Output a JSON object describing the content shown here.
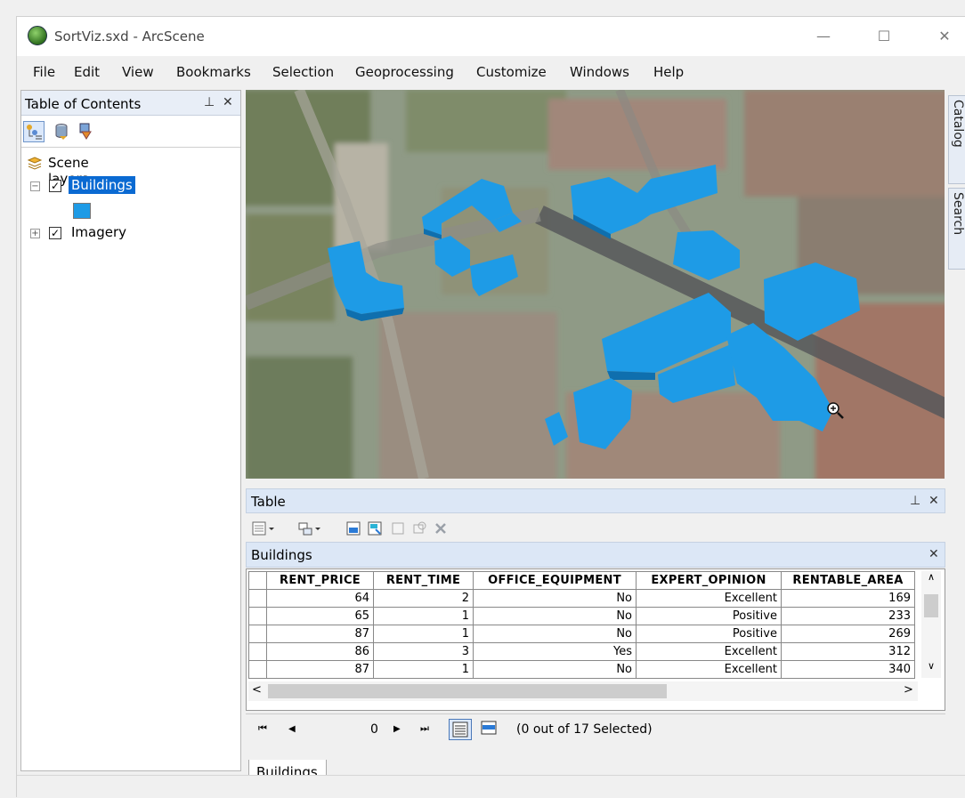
{
  "window": {
    "title": "SortViz.sxd - ArcScene",
    "minimize": "—",
    "maximize": "☐",
    "close": "✕"
  },
  "menu": [
    "File",
    "Edit",
    "View",
    "Bookmarks",
    "Selection",
    "Geoprocessing",
    "Customize",
    "Windows",
    "Help"
  ],
  "toc": {
    "title": "Table of Contents",
    "pin": "⊥",
    "close": "✕",
    "root_label": "Scene layers",
    "layers": [
      {
        "name": "Buildings",
        "checked": "✓",
        "expander": "−",
        "selected": true
      },
      {
        "name": "Imagery",
        "checked": "✓",
        "expander": "+",
        "selected": false
      }
    ],
    "symbol_color": "#1e9be6"
  },
  "side_tabs": [
    "Catalog",
    "Search"
  ],
  "table_panel": {
    "title": "Table",
    "pin": "⊥",
    "close": "✕",
    "layer_title": "Buildings",
    "layer_close": "✕",
    "columns": [
      "RENT_PRICE",
      "RENT_TIME",
      "OFFICE_EQUIPMENT",
      "EXPERT_OPINION",
      "RENTABLE_AREA"
    ],
    "rows": [
      [
        "64",
        "2",
        "No",
        "Excellent",
        "169"
      ],
      [
        "65",
        "1",
        "No",
        "Positive",
        "233"
      ],
      [
        "87",
        "1",
        "No",
        "Positive",
        "269"
      ],
      [
        "86",
        "3",
        "Yes",
        "Excellent",
        "312"
      ],
      [
        "87",
        "1",
        "No",
        "Excellent",
        "340"
      ]
    ],
    "record": "0",
    "selection_text": "(0 out of 17 Selected)",
    "bottom_tab": "Buildings",
    "scroll_up": "∧",
    "scroll_down": "∨",
    "scroll_left": "<",
    "scroll_right": ">",
    "nav_first": "⏮",
    "nav_prev": "◀",
    "nav_next": "▶",
    "nav_last": "⏭"
  },
  "colors": {
    "building": "#1e9be6",
    "building_dark": "#0f6fae",
    "selection": "#0a6ad2"
  }
}
